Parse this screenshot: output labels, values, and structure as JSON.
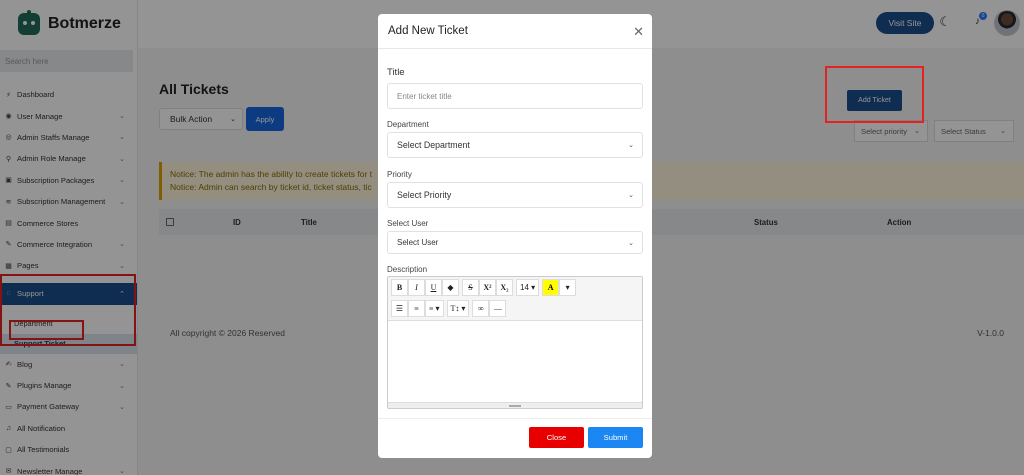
{
  "brand": {
    "name": "Botmerze"
  },
  "sidebar": {
    "search_placeholder": "Search here",
    "items": [
      {
        "label": "Dashboard",
        "icon": "dashboard-icon",
        "has_chevron": false
      },
      {
        "label": "User Manage",
        "icon": "user-icon",
        "has_chevron": true
      },
      {
        "label": "Admin Staffs Manage",
        "icon": "staff-icon",
        "has_chevron": true
      },
      {
        "label": "Admin Role Manage",
        "icon": "role-icon",
        "has_chevron": true
      },
      {
        "label": "Subscription Packages",
        "icon": "package-icon",
        "has_chevron": true
      },
      {
        "label": "Subscription Management",
        "icon": "subscription-icon",
        "has_chevron": true
      },
      {
        "label": "Commerce Stores",
        "icon": "store-icon",
        "has_chevron": false
      },
      {
        "label": "Commerce Integration",
        "icon": "plug-icon",
        "has_chevron": true
      },
      {
        "label": "Pages",
        "icon": "pages-icon",
        "has_chevron": true
      },
      {
        "label": "Support",
        "icon": "support-icon",
        "has_chevron": true,
        "active": true
      }
    ],
    "support_sub": [
      {
        "label": "Department"
      },
      {
        "label": "Support Ticket"
      }
    ],
    "items_after": [
      {
        "label": "Blog",
        "icon": "blog-icon",
        "has_chevron": true
      },
      {
        "label": "Plugins Manage",
        "icon": "plugin-icon",
        "has_chevron": true
      },
      {
        "label": "Payment Gateway",
        "icon": "payment-icon",
        "has_chevron": true
      },
      {
        "label": "All Notification",
        "icon": "bell-icon",
        "has_chevron": false
      },
      {
        "label": "All Testimonials",
        "icon": "testimonial-icon",
        "has_chevron": false
      },
      {
        "label": "Newsletter Manage",
        "icon": "newsletter-icon",
        "has_chevron": true
      }
    ]
  },
  "topbar": {
    "visit_site": "Visit Site",
    "notification_count": "0"
  },
  "main": {
    "title": "All Tickets",
    "bulk_action": "Bulk Action",
    "apply": "Apply",
    "add_ticket": "Add Ticket",
    "select_priority": "Select priority",
    "select_status": "Select Status",
    "notice_1": "Notice: The admin has the ability to create tickets for t",
    "notice_2": "Notice: Admin can search by ticket id, ticket status, tic",
    "table_headers": {
      "id": "ID",
      "title": "Title",
      "status": "Status",
      "action": "Action"
    },
    "copyright": "All copyright © 2026 Reserved",
    "version": "V-1.0.0"
  },
  "modal": {
    "title": "Add New Ticket",
    "title_label": "Title",
    "title_placeholder": "Enter ticket title",
    "department_label": "Department",
    "department_value": "Select Department",
    "priority_label": "Priority",
    "priority_value": "Select Priority",
    "user_label": "Select User",
    "user_value": "Select User",
    "description_label": "Description",
    "font_size": "14",
    "close": "Close",
    "submit": "Submit"
  },
  "colors": {
    "brand": "#1a4e8a",
    "highlight_red": "#e32222",
    "close_btn": "#e80000",
    "submit_btn": "#1c86f2"
  }
}
